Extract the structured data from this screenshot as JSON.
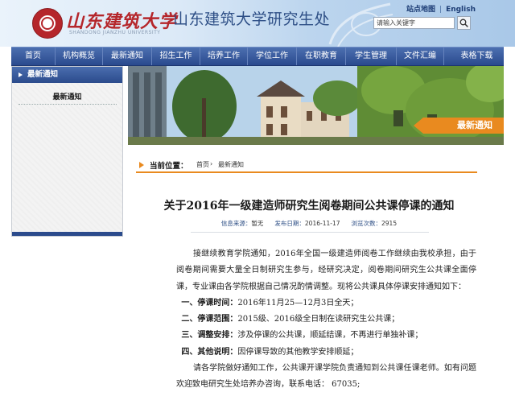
{
  "header": {
    "logo_text": "山东建筑大学",
    "logo_subtext": "SHANDONG JIANZHU UNIVERSITY",
    "site_title": "山东建筑大学研究生处",
    "sitemap_link": "站点地图",
    "english_link": "English",
    "search_placeholder": "请输入关键字"
  },
  "nav": {
    "items": [
      "首页",
      "机构概览",
      "最新通知",
      "招生工作",
      "培养工作",
      "学位工作",
      "在职教育",
      "学生管理",
      "文件汇编",
      "表格下载"
    ]
  },
  "sidebar": {
    "heading": "最新通知",
    "items": [
      "最新通知"
    ]
  },
  "banner": {
    "tag": "最新通知"
  },
  "breadcrumb": {
    "label": "当前位置：",
    "home": "首页",
    "separator": "›",
    "current": "最新通知"
  },
  "article": {
    "title": "关于2016年一级建造师研究生阅卷期间公共课停课的通知",
    "meta": {
      "source_label": "信息来源：",
      "source_value": "暂无",
      "date_label": "发布日期：",
      "date_value": "2016-11-17",
      "views_label": "浏览次数：",
      "views_value": "2915"
    },
    "intro": "接继续教育学院通知，2016年全国一级建造师阅卷工作继续由我校承担，由于阅卷期间需要大量全日制研究生参与，经研究决定，阅卷期间研究生公共课全面停课，专业课由各学院根据自己情况酌情调整。现将公共课具体停课安排通知如下：",
    "items": [
      {
        "label": "一、停课时间：",
        "text": "2016年11月25—12月3日全天；"
      },
      {
        "label": "二、停课范围：",
        "text": "2015级、2016级全日制在读研究生公共课；"
      },
      {
        "label": "三、调整安排：",
        "text": "涉及停课的公共课，顺延结课，不再进行单独补课；"
      },
      {
        "label": "四、其他说明：",
        "text": "因停课导致的其他教学安排顺延；"
      }
    ],
    "closing": "请各学院做好通知工作，公共课开课学院负责通知到公共课任课老师。如有问题欢迎致电研究生处培养办咨询，联系电话：  67035;"
  },
  "colors": {
    "nav_blue": "#2a4a8e",
    "accent_orange": "#e98a1f",
    "logo_red": "#b5262b",
    "title_blue": "#2e4f86"
  }
}
